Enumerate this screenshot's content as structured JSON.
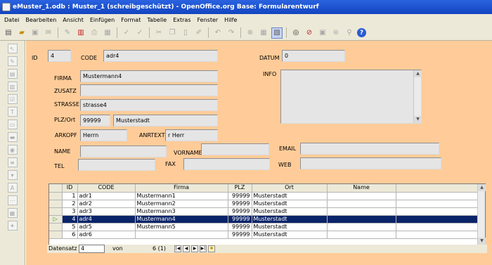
{
  "window": {
    "title": "eMuster_1.odb : Muster_1 (schreibgeschützt) - OpenOffice.org Base: Formularentwurf"
  },
  "menu": [
    "Datei",
    "Bearbeiten",
    "Ansicht",
    "Einfügen",
    "Format",
    "Tabelle",
    "Extras",
    "Fenster",
    "Hilfe"
  ],
  "toolbar_icons": [
    "new-document-icon",
    "open-folder-icon",
    "save-icon",
    "email-icon",
    "edit-file-icon",
    "export-pdf-icon",
    "print-icon",
    "page-preview-icon",
    "spellcheck-icon",
    "autospellcheck-icon",
    "cut-icon",
    "copy-icon",
    "paste-icon",
    "format-paintbrush-icon",
    "undo-icon",
    "redo-icon",
    "hyperlink-icon",
    "table-icon",
    "design-mode-icon",
    "find-icon",
    "navigator-icon",
    "gallery-icon",
    "datasource-icon",
    "zoom-icon",
    "help-icon"
  ],
  "form": {
    "id": {
      "label": "ID",
      "value": "4"
    },
    "code": {
      "label": "CODE",
      "value": "adr4"
    },
    "datum": {
      "label": "DATUM",
      "value": "0"
    },
    "firma": {
      "label": "FIRMA",
      "value": "Mustermann4"
    },
    "zusatz": {
      "label": "ZUSATZ",
      "value": ""
    },
    "strasse": {
      "label": "STRASSE",
      "value": "strasse4"
    },
    "plz_ort": {
      "label": "PLZ/Ort",
      "plz": "99999",
      "ort": "Musterstadt"
    },
    "arkopf": {
      "label": "ARKOPF",
      "value": "Herrn"
    },
    "anrtext": {
      "label": "ANRTEXT",
      "value": "r Herr"
    },
    "info": {
      "label": "INFO"
    },
    "name": {
      "label": "NAME",
      "value": ""
    },
    "vorname": {
      "label": "VORNAME",
      "value": ""
    },
    "email": {
      "label": "EMAIL",
      "value": ""
    },
    "tel": {
      "label": "TEL",
      "value": ""
    },
    "fax": {
      "label": "FAX",
      "value": ""
    },
    "web": {
      "label": "WEB",
      "value": ""
    }
  },
  "grid": {
    "columns": [
      "ID",
      "CODE",
      "Firma",
      "PLZ",
      "Ort",
      "Name"
    ],
    "rows": [
      [
        "1",
        "adr1",
        "Mustermann1",
        "99999",
        "Musterstadt",
        ""
      ],
      [
        "2",
        "adr2",
        "Mustermann2",
        "99999",
        "Musterstadt",
        ""
      ],
      [
        "3",
        "adr3",
        "Mustermann3",
        "99999",
        "Musterstadt",
        ""
      ],
      [
        "4",
        "adr4",
        "Mustermann4",
        "99999",
        "Musterstadt",
        ""
      ],
      [
        "5",
        "adr5",
        "Mustermann5",
        "99999",
        "Musterstadt",
        ""
      ],
      [
        "6",
        "adr6",
        "",
        "99999",
        "Musterstadt",
        ""
      ]
    ],
    "current_row_index": 3
  },
  "navigation": {
    "label": "Datensatz",
    "record": "4",
    "of_label": "von",
    "count": "6 (1)"
  }
}
